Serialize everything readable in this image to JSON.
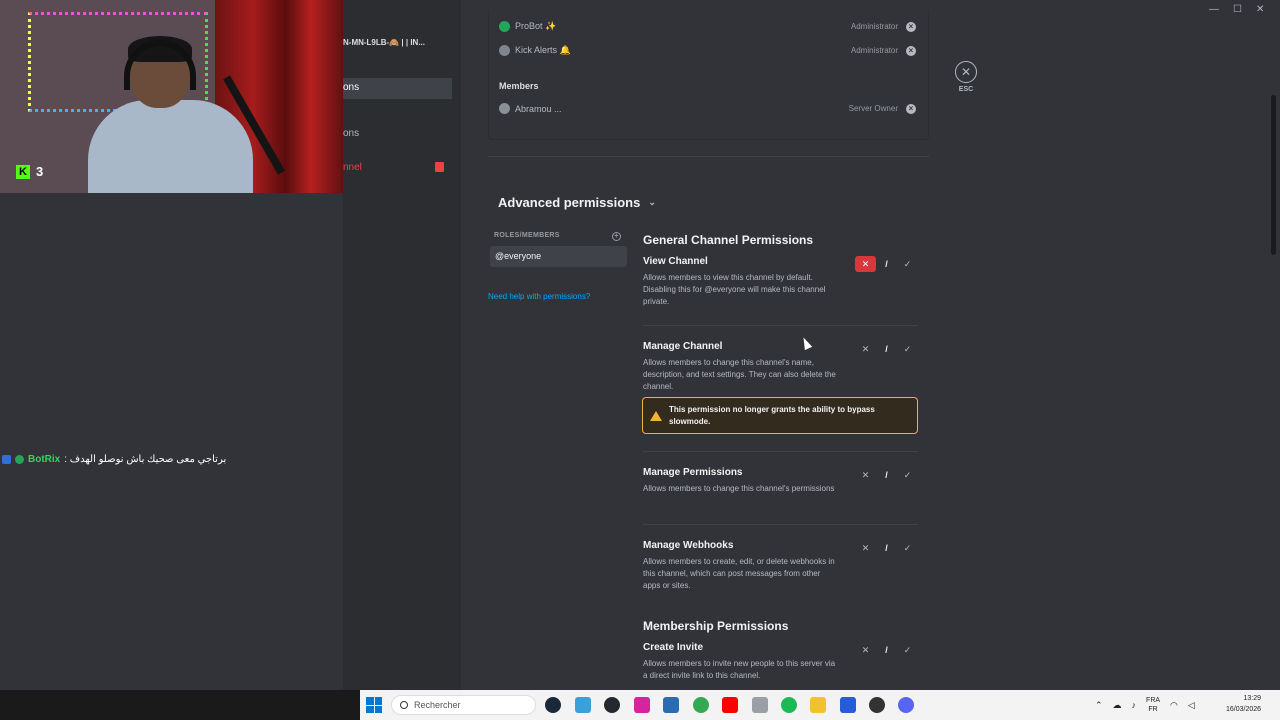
{
  "stream": {
    "follower_badge": "3",
    "chat": {
      "user": "BotRix",
      "message": ": برتاجي معى صحيك باش نوصلو الهدف"
    }
  },
  "sidebar": {
    "server_name": "N-MN-L9LB-🙈 | | IN...",
    "items": [
      {
        "label": "ons"
      },
      {
        "label": "ons"
      },
      {
        "label": "nnel"
      }
    ]
  },
  "roles_list": [
    {
      "name": "ProBot ✨",
      "tag": "Administrator",
      "icon_color": "#23a55a"
    },
    {
      "name": "Kick Alerts 🔔",
      "tag": "Administrator",
      "icon_color": "#80848e"
    }
  ],
  "members_heading": "Members",
  "members_list": [
    {
      "name": "Abramou ...",
      "tag": "Server Owner"
    }
  ],
  "advanced": {
    "title": "Advanced permissions",
    "roles_header": "ROLES/MEMBERS",
    "selected_role": "@everyone",
    "help_link": "Need help with permissions?"
  },
  "sections": {
    "general": "General Channel Permissions",
    "membership": "Membership Permissions"
  },
  "permissions": [
    {
      "name": "View Channel",
      "desc": "Allows members to view this channel by default. Disabling this for @everyone will make this channel private.",
      "state": "deny"
    },
    {
      "name": "Manage Channel",
      "desc": "Allows members to change this channel's name, description, and text settings. They can also delete the channel.",
      "state": "neutral"
    },
    {
      "name": "Manage Permissions",
      "desc": "Allows members to change this channel's permissions",
      "state": "neutral"
    },
    {
      "name": "Manage Webhooks",
      "desc": "Allows members to create, edit, or delete webhooks in this channel, which can post messages from other apps or sites.",
      "state": "neutral"
    },
    {
      "name": "Create Invite",
      "desc": "Allows members to invite new people to this server via a direct invite link to this channel.",
      "state": "neutral"
    }
  ],
  "warning": "This permission no longer grants the ability to bypass slowmode.",
  "toggles": {
    "deny": "✕",
    "neutral": "/",
    "allow": "✓"
  },
  "esc": {
    "icon": "close-icon",
    "label": "ESC"
  },
  "taskbar": {
    "search_placeholder": "Rechercher",
    "lang_line1": "FRA",
    "lang_line2": "FR",
    "time": "13:29",
    "date": "16/03/2026"
  },
  "colors": {
    "accent": "#5865f2",
    "deny": "#da373c",
    "warning": "#f0b232",
    "link": "#00a8fc"
  }
}
